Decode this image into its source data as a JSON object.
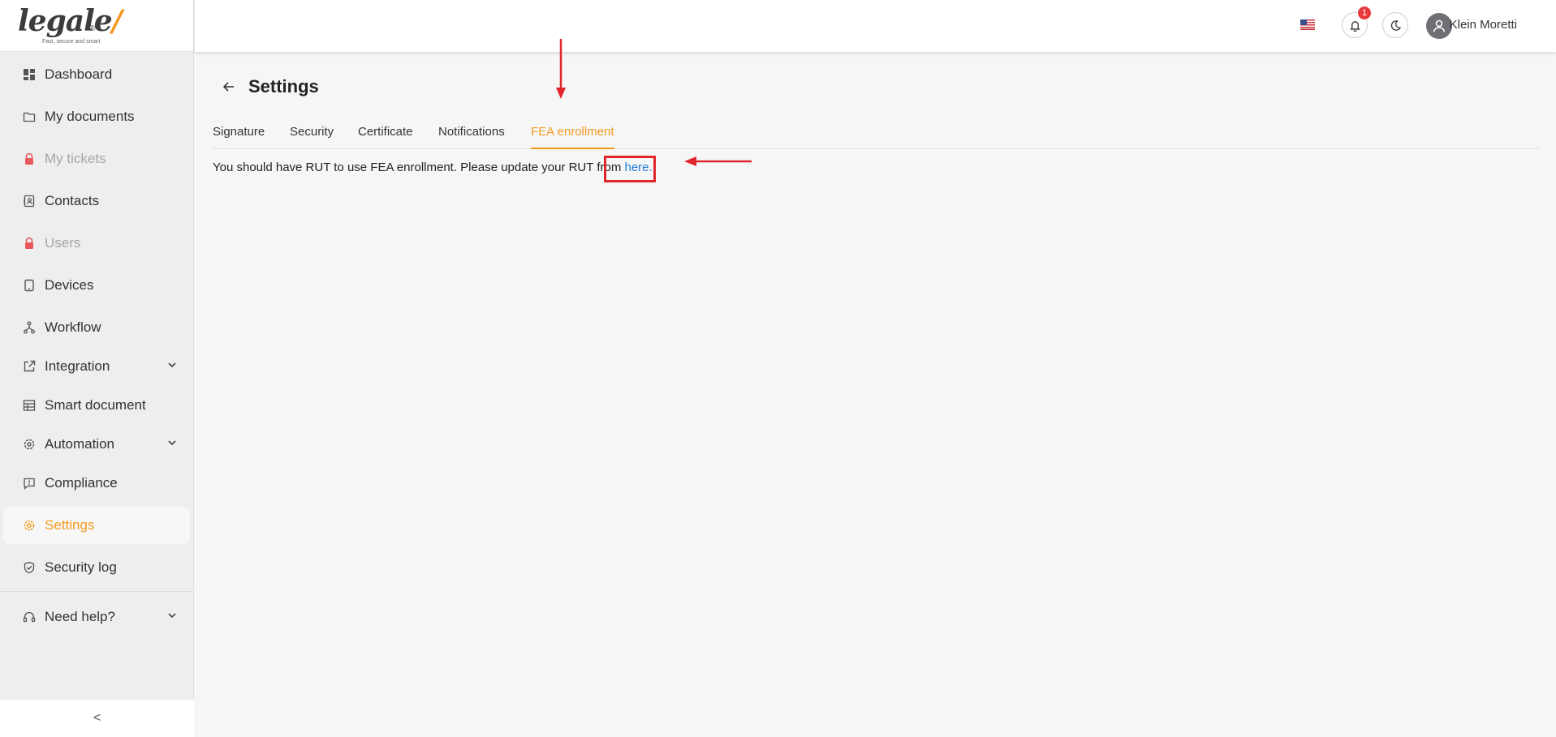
{
  "brand": {
    "name": "legale",
    "tick": "/",
    "registered": "®",
    "tagline": "Fast, secure and smart"
  },
  "sidebar": {
    "items": [
      {
        "label": "Dashboard",
        "icon": "dashboard-icon",
        "state": "normal"
      },
      {
        "label": "My documents",
        "icon": "folder-icon",
        "state": "normal"
      },
      {
        "label": "My tickets",
        "icon": "lock-icon",
        "state": "locked"
      },
      {
        "label": "Contacts",
        "icon": "contacts-icon",
        "state": "normal"
      },
      {
        "label": "Users",
        "icon": "lock-icon",
        "state": "locked"
      },
      {
        "label": "Devices",
        "icon": "tablet-icon",
        "state": "normal"
      },
      {
        "label": "Workflow",
        "icon": "workflow-icon",
        "state": "normal"
      },
      {
        "label": "Integration",
        "icon": "external-link-icon",
        "state": "expandable"
      },
      {
        "label": "Smart document",
        "icon": "table-icon",
        "state": "normal"
      },
      {
        "label": "Automation",
        "icon": "automation-gear-icon",
        "state": "expandable"
      },
      {
        "label": "Compliance",
        "icon": "message-alert-icon",
        "state": "normal"
      },
      {
        "label": "Settings",
        "icon": "gear-icon",
        "state": "active"
      },
      {
        "label": "Security log",
        "icon": "shield-check-icon",
        "state": "normal"
      },
      {
        "label": "Need help?",
        "icon": "headset-icon",
        "state": "expandable"
      }
    ],
    "collapse_label": "<"
  },
  "topbar": {
    "notification_count": "1",
    "user_name": "Klein Moretti",
    "language_flag": "us-flag-icon"
  },
  "page": {
    "title": "Settings",
    "tabs": [
      "Signature",
      "Security",
      "Certificate",
      "Notifications",
      "FEA enrollment"
    ],
    "active_tab": "FEA enrollment",
    "notice_text": "You should have RUT to use FEA enrollment. Please update your RUT from ",
    "notice_link": "here."
  },
  "colors": {
    "accent": "#f39a1e",
    "link": "#1f7ad6",
    "locked": "#e8585c",
    "annotation": "#e1262b",
    "badge": "#e8383d"
  }
}
